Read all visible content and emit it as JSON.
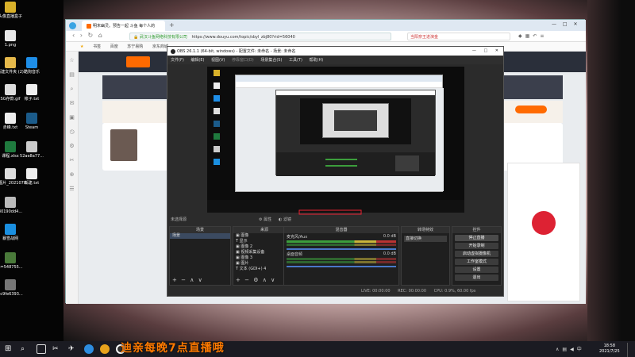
{
  "desktop": {
    "icons": [
      {
        "label": "头像直播盒子",
        "icon": "box-icon",
        "color": "#d9b12a"
      },
      {
        "label": "1.png",
        "icon": "image-file-icon",
        "color": "#e8e8e8"
      },
      {
        "label": "新建文件夹 (2)",
        "icon": "folder-icon",
        "color": "#e6b94b"
      },
      {
        "label": "酷狗音乐",
        "icon": "kugou-icon",
        "color": "#1e8ee8"
      },
      {
        "label": "SG存款.gif",
        "icon": "gif-file-icon",
        "color": "#dddddd"
      },
      {
        "label": "帐子.txt",
        "icon": "text-file-icon",
        "color": "#eeeeee"
      },
      {
        "label": "赤峰.txt",
        "icon": "text-file-icon",
        "color": "#eeeeee"
      },
      {
        "label": "Steam",
        "icon": "steam-icon",
        "color": "#1b5b8a"
      },
      {
        "label": "课程.xlsx",
        "icon": "excel-icon",
        "color": "#1f7a3e"
      },
      {
        "label": "52ae8a77...",
        "icon": "image-file-icon",
        "color": "#cccccc"
      },
      {
        "label": "微信图片_2021070...",
        "icon": "image-file-icon",
        "color": "#dddddd"
      },
      {
        "label": "新建.txt",
        "icon": "text-file-icon",
        "color": "#eeeeee"
      },
      {
        "label": "80190dd4...",
        "icon": "image-file-icon",
        "color": "#bbbbbb"
      },
      {
        "label": "暴雪战网",
        "icon": "battlenet-icon",
        "color": "#1a8fe0"
      },
      {
        "label": "u=548755...",
        "icon": "image-file-icon",
        "color": "#4a7a3a"
      },
      {
        "label": "ec9fe6393...",
        "icon": "image-file-icon",
        "color": "#777777"
      }
    ]
  },
  "browser": {
    "tab_title": "明末幽灵。预告一起 斗鱼 每个人的",
    "new_tab": "+",
    "url_secure_label": "武汉斗鱼网络科技有限公司",
    "url": "https://www.douyu.com/topic/sbyl_zbj80?rid=56040",
    "search_hint": "当阳奈王进演金",
    "bookmarks": [
      "书签",
      "百度",
      "苏宁易购",
      "京东商城"
    ],
    "window_controls": [
      "—",
      "□",
      "✕"
    ]
  },
  "obs": {
    "title": "OBS 26.1.1 (64-bit, windows) - 配置文件: 未命名 - 场景: 未命名",
    "menu": [
      "文件(F)",
      "编辑(E)",
      "视图(V)",
      "停靠窗口(D)",
      "场景集合(S)",
      "工具(T)",
      "帮助(H)"
    ],
    "scene_header": "未选择源",
    "scene_header_buttons": [
      "属性",
      "滤镜"
    ],
    "docks": {
      "scenes": {
        "title": "场景",
        "items": [
          "场景"
        ]
      },
      "sources": {
        "title": "来源",
        "items": [
          "图像",
          "显示",
          "图像 2",
          "视频采集设备",
          "图像 3",
          "图片",
          "文本 (GDI+) 4"
        ]
      },
      "mixer": {
        "title": "混音器",
        "channels": [
          {
            "name": "麦克风/Aux",
            "db": "0.0 dB"
          },
          {
            "name": "桌面音频",
            "db": "0.0 dB"
          }
        ]
      },
      "transitions": {
        "title": "转场特效",
        "value": "直接切换"
      },
      "controls": {
        "title": "控件",
        "buttons": [
          "停止直播",
          "开始录制",
          "启动虚拟摄像机",
          "工作室模式",
          "设置",
          "退出"
        ]
      }
    },
    "status": {
      "live": "LIVE: 00:00:00",
      "rec": "REC: 00:00:00",
      "cpu": "CPU: 0.9%, 60.00 fps"
    }
  },
  "overlay_text": "迪亲每晚7点直播哦",
  "taskbar": {
    "time": "18:58",
    "date": "2021/7/25"
  },
  "colors": {
    "overlay": "#ff7a00",
    "douyu_orange": "#ff6a00",
    "obs_dark": "#2b2b2b"
  }
}
